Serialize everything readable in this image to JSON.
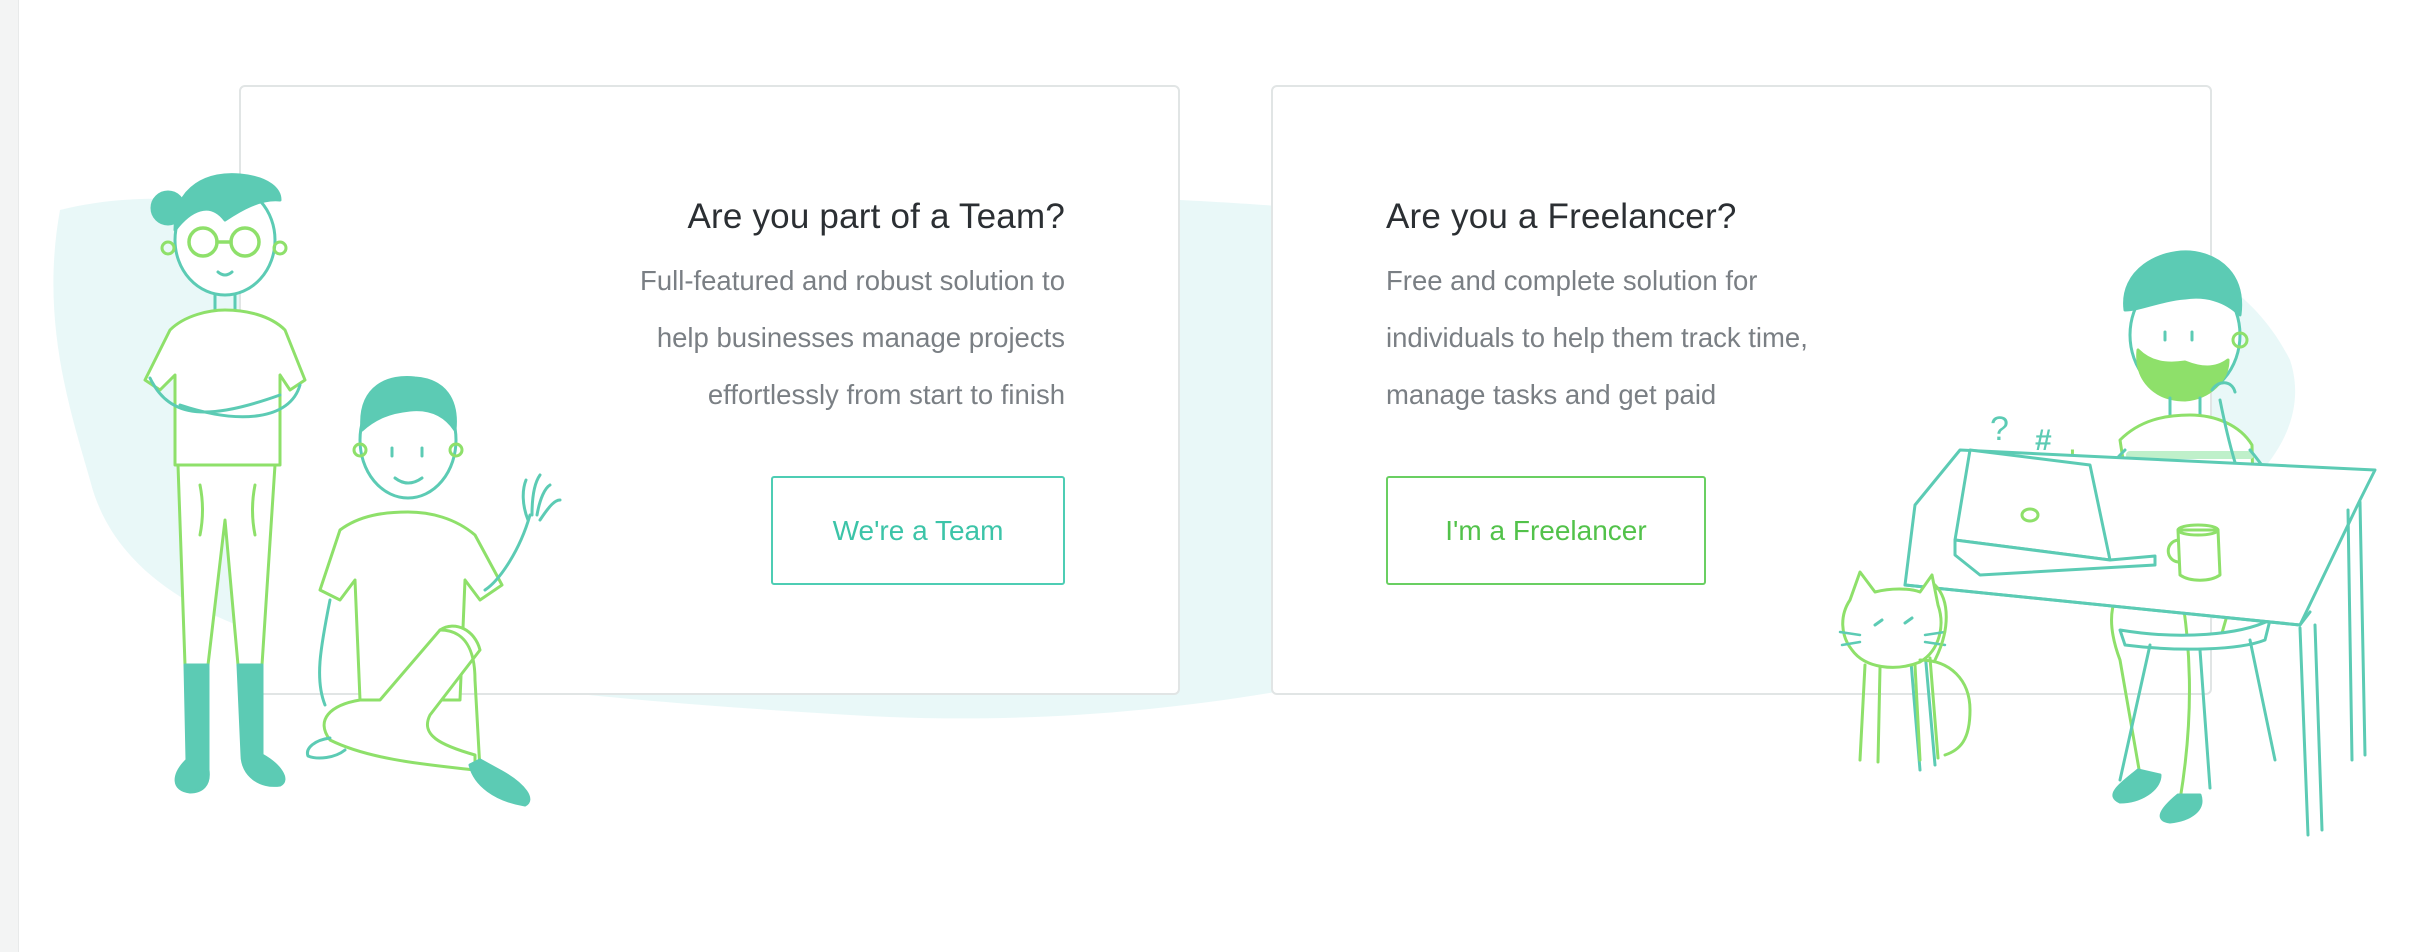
{
  "cards": {
    "team": {
      "title": "Are you part of a Team?",
      "description_lines": [
        "Full-featured and robust solution to",
        "help businesses manage projects",
        "effortlessly from start to finish"
      ],
      "button_label": "We're a Team"
    },
    "freelancer": {
      "title": "Are you a Freelancer?",
      "description_lines": [
        "Free and complete solution for",
        "individuals to help them track time,",
        "manage tasks and get paid"
      ],
      "button_label": "I'm a Freelancer"
    }
  },
  "illustrations": {
    "team_people": "team-people-illustration",
    "freelancer_at_desk": "freelancer-desk-illustration",
    "doodle_symbols": [
      "?",
      "#",
      "!"
    ]
  },
  "colors": {
    "teal": "#5ccbb4",
    "green": "#8ee06a",
    "splash": "#dff4f4",
    "title": "#2b2f33",
    "body_text": "#7a7f84",
    "card_border": "#e1e5e5"
  }
}
